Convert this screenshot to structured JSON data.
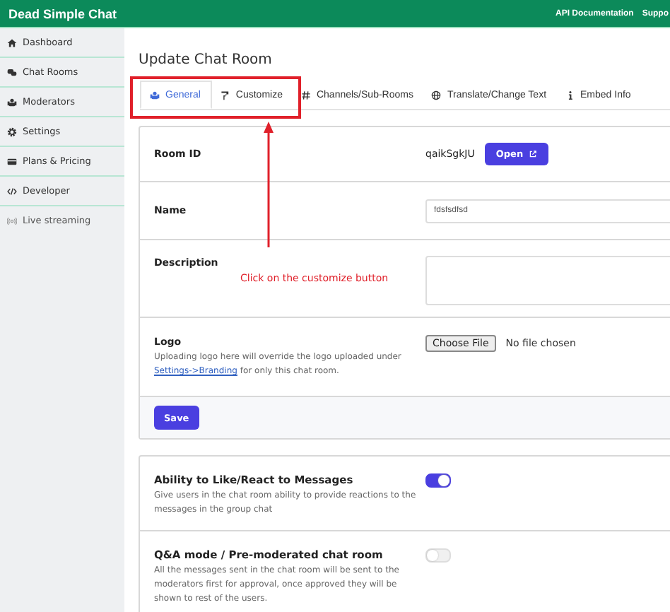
{
  "header": {
    "brand": "Dead Simple Chat",
    "links": [
      "API Documentation",
      "Suppo"
    ]
  },
  "sidebar": {
    "items": [
      {
        "label": "Dashboard"
      },
      {
        "label": "Chat Rooms"
      },
      {
        "label": "Moderators"
      },
      {
        "label": "Settings"
      },
      {
        "label": "Plans & Pricing"
      },
      {
        "label": "Developer"
      },
      {
        "label": "Live streaming"
      }
    ]
  },
  "page_title": "Update Chat Room",
  "tabs": [
    {
      "label": "General",
      "selected": true
    },
    {
      "label": "Customize",
      "selected": false
    },
    {
      "label": "Channels/Sub-Rooms",
      "selected": false
    },
    {
      "label": "Translate/Change Text",
      "selected": false
    },
    {
      "label": "Embed Info",
      "selected": false
    }
  ],
  "form": {
    "room_id": {
      "label": "Room ID",
      "value": "qaikSgkJU",
      "button": "Open"
    },
    "name": {
      "label": "Name",
      "value": "fdsfsdfsd"
    },
    "description": {
      "label": "Description"
    },
    "logo": {
      "label": "Logo",
      "help": "Uploading logo here will override the logo uploaded under",
      "link": "Settings->Branding",
      "help_end": "for only this chat room.",
      "file_button": "Choose File",
      "file_status": "No file chosen"
    },
    "save": "Save"
  },
  "toggles": [
    {
      "title": "Ability to Like/React to Messages",
      "description": "Give users in the chat room ability to provide reactions to the messages in the group chat",
      "on": true
    },
    {
      "title": "Q&A mode / Pre-moderated chat room",
      "description": "All the messages sent in the chat room will be sent to the moderators first for approval, once approved they will be shown to rest of the users.",
      "on": false
    }
  ],
  "annotation": {
    "text": "Click on the customize button"
  }
}
